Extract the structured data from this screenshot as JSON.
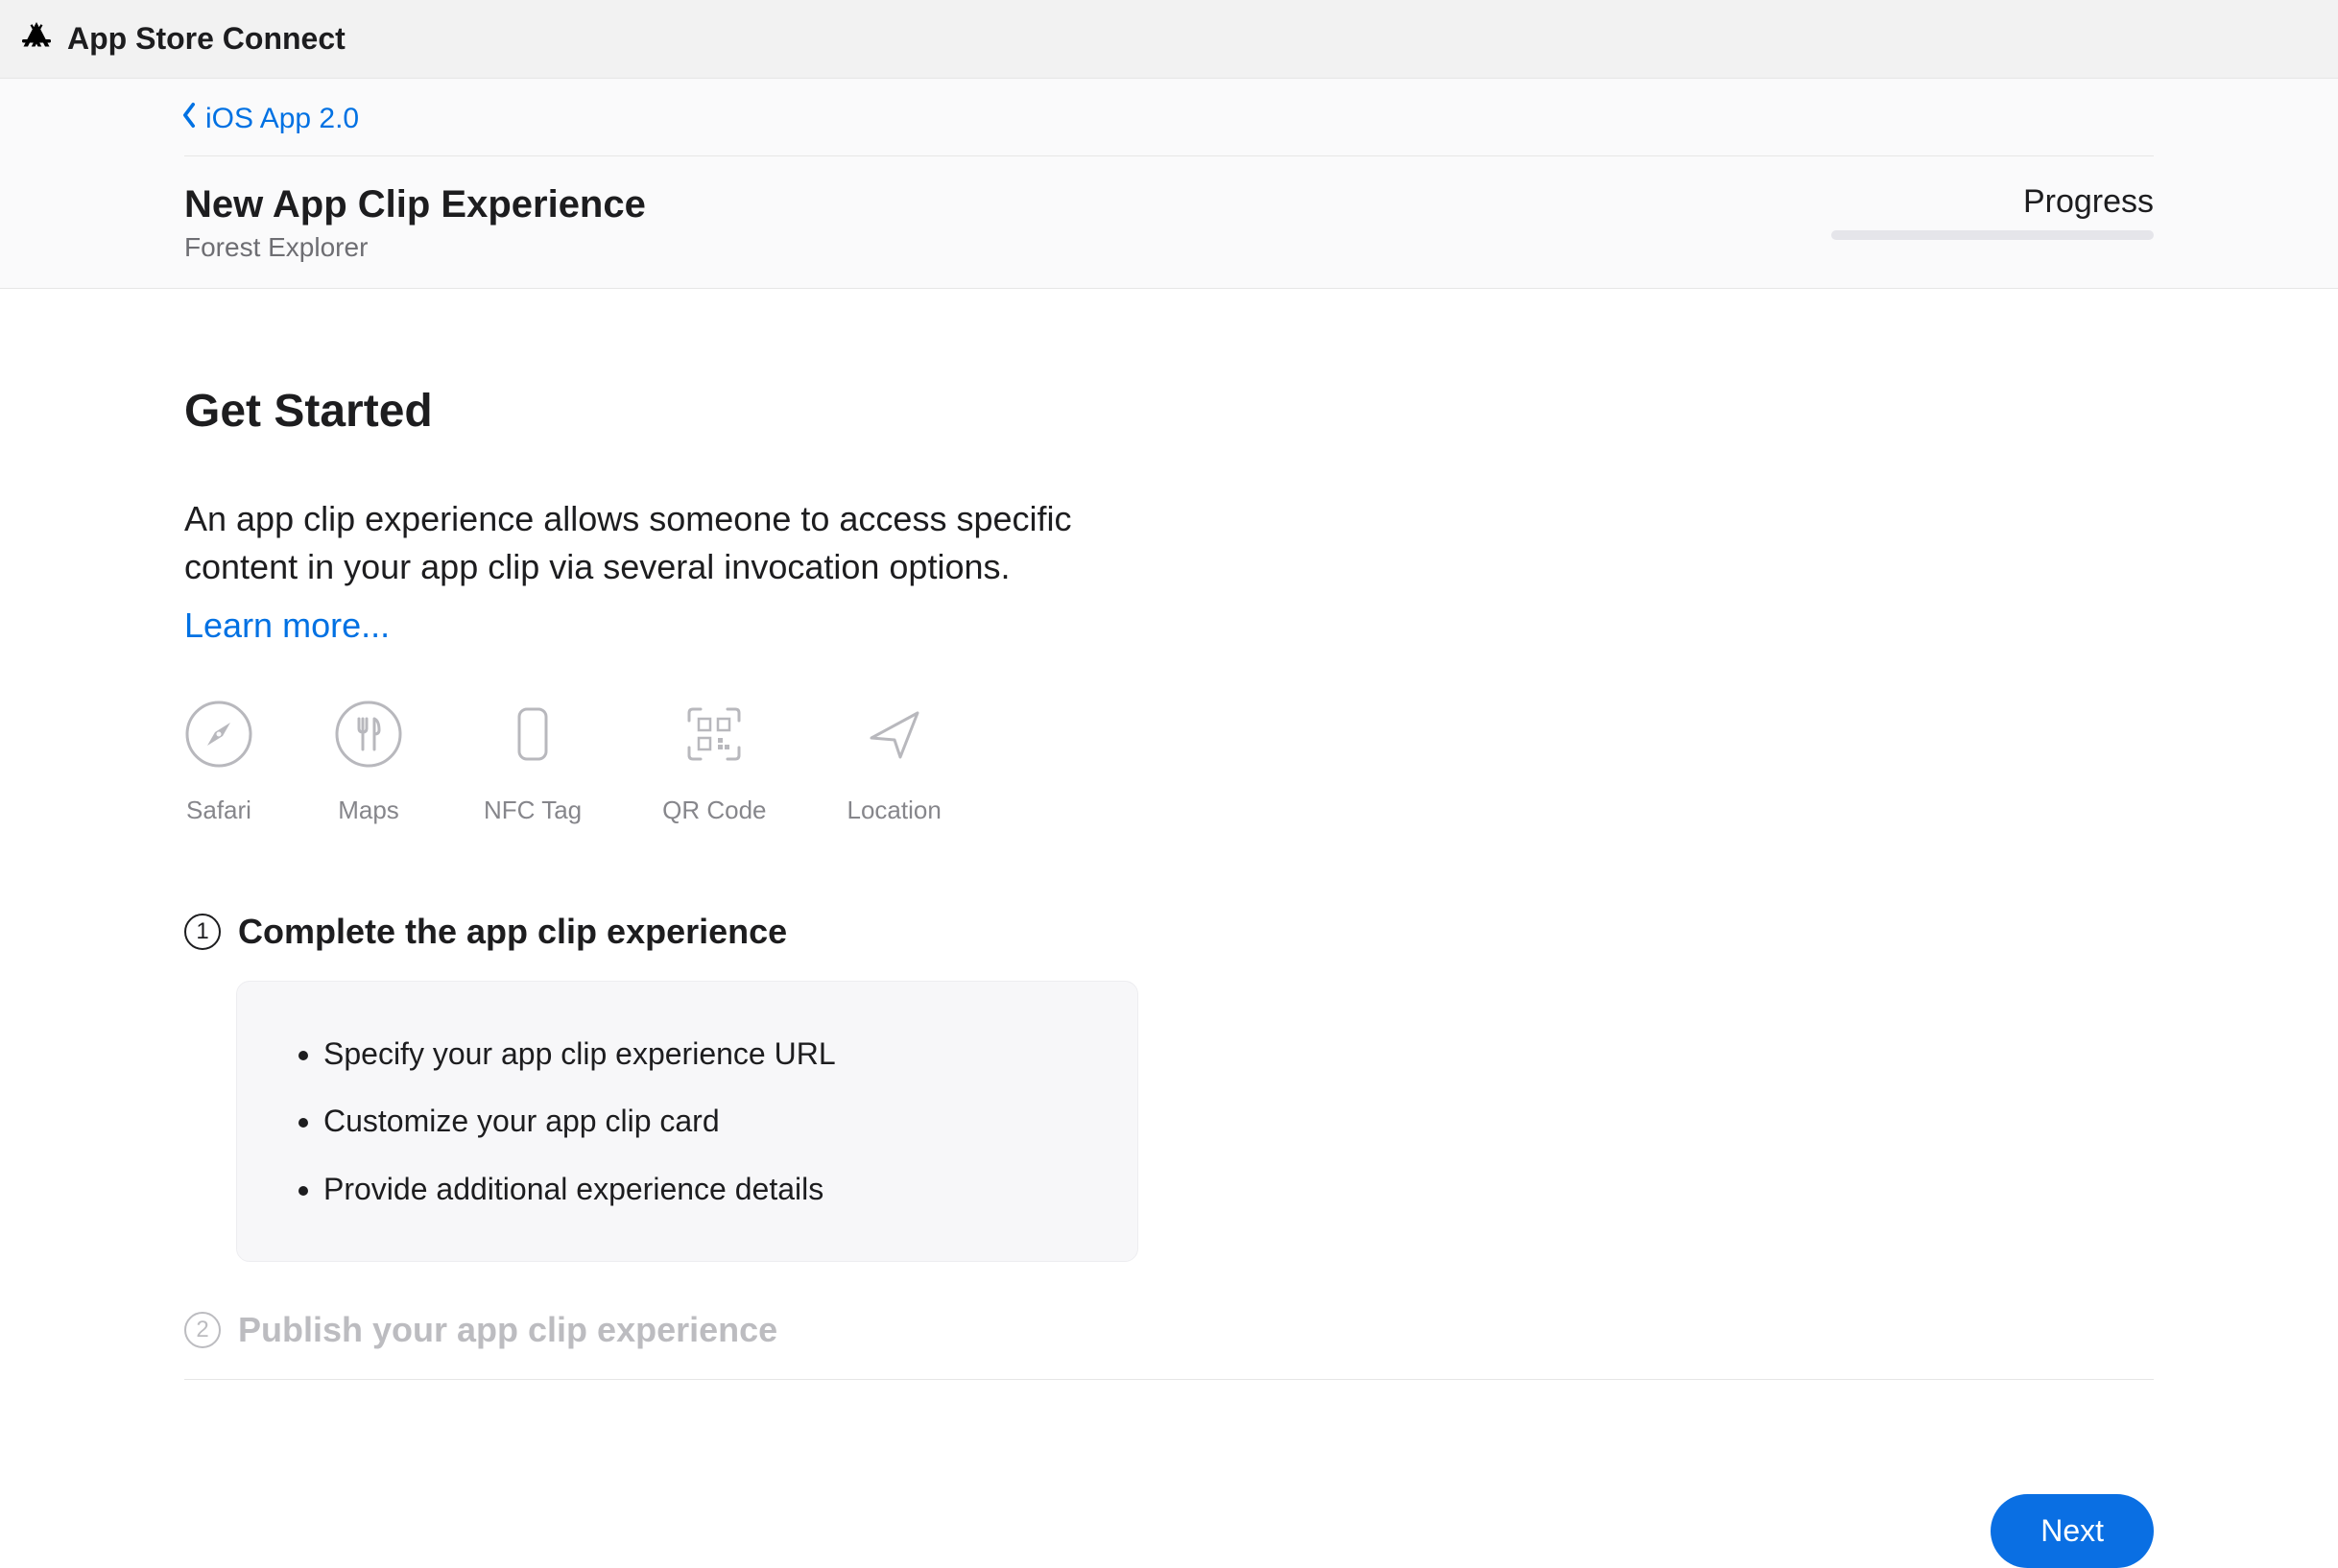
{
  "topbar": {
    "title": "App Store Connect"
  },
  "breadcrumb": {
    "back_label": "iOS App 2.0"
  },
  "page": {
    "title": "New App Clip Experience",
    "subtitle": "Forest Explorer",
    "progress_label": "Progress"
  },
  "main": {
    "heading": "Get Started",
    "intro": "An app clip experience allows someone to access specific content in your app clip via several invocation options.",
    "learn_more": "Learn more...",
    "invocations": [
      {
        "label": "Safari",
        "icon": "compass-icon"
      },
      {
        "label": "Maps",
        "icon": "fork-knife-icon"
      },
      {
        "label": "NFC Tag",
        "icon": "phone-nfc-icon"
      },
      {
        "label": "QR Code",
        "icon": "qr-code-icon"
      },
      {
        "label": "Location",
        "icon": "navigation-arrow-icon"
      }
    ],
    "step1": {
      "num": "1",
      "title": "Complete the app clip experience",
      "tasks": [
        "Specify your app clip experience URL",
        "Customize your app clip card",
        "Provide additional experience details"
      ]
    },
    "step2": {
      "num": "2",
      "title": "Publish your app clip experience"
    }
  },
  "actions": {
    "next": "Next"
  }
}
